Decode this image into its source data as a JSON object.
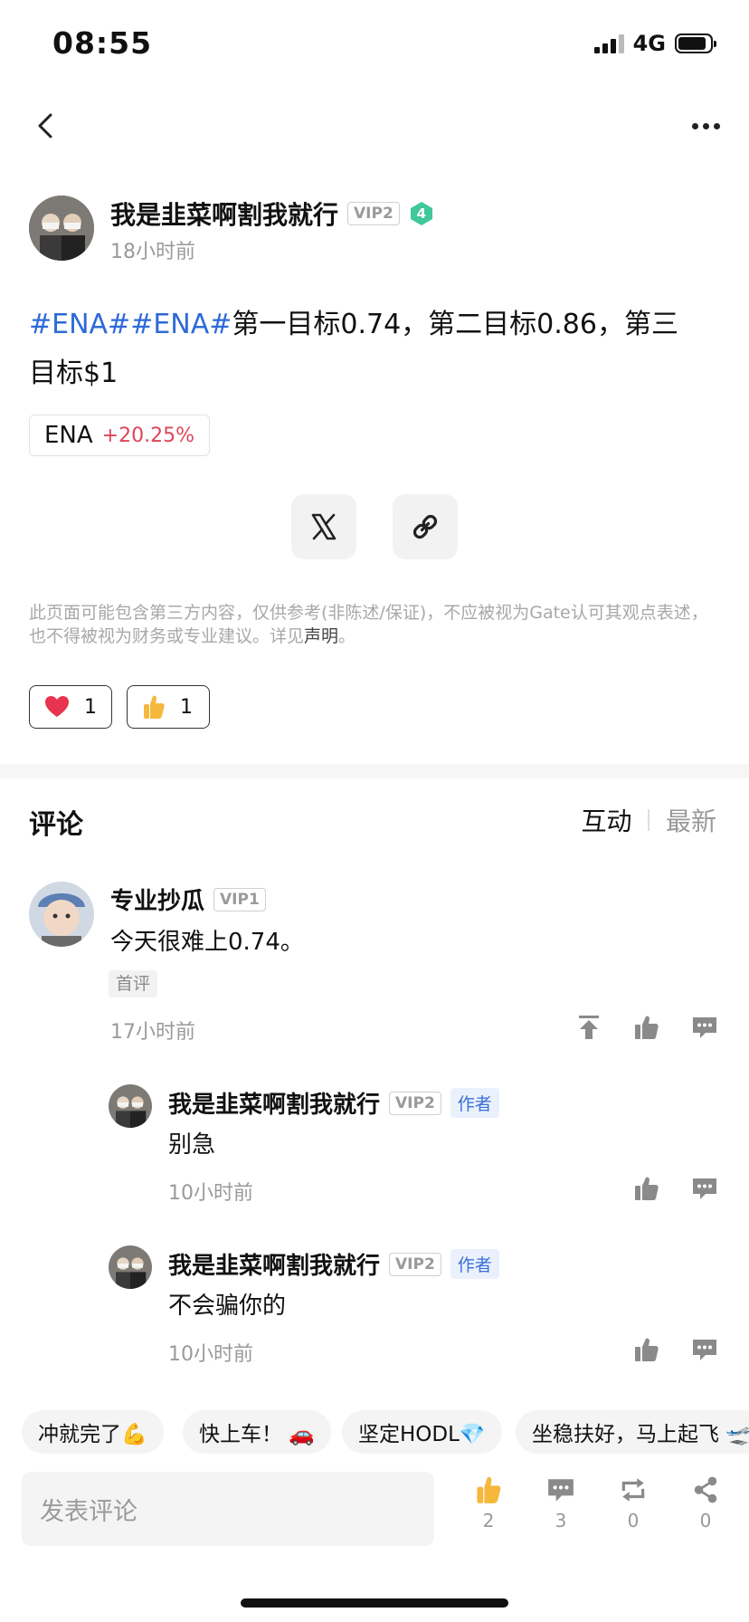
{
  "status_bar": {
    "time": "08:55",
    "network": "4G"
  },
  "post": {
    "author": {
      "name": "我是韭菜啊割我就行",
      "vip": "VIP2",
      "level": "4",
      "time": "18小时前"
    },
    "tags": "#ENA##ENA#",
    "text_line1": "第一目标0.74，第二目标0.86，第三",
    "text_line2": "目标$1",
    "coin": {
      "symbol": "ENA",
      "change": "+20.25%"
    },
    "disclaimer_main": "此页面可能包含第三方内容，仅供参考(非陈述/保证)，不应被视为Gate认可其观点表述，也不得被视为财务或专业建议。详见",
    "disclaimer_link": "声明",
    "disclaimer_end": "。",
    "reactions": [
      {
        "icon": "heart-icon",
        "count": "1"
      },
      {
        "icon": "thumbs-up-emoji-icon",
        "count": "1"
      }
    ]
  },
  "comments_section": {
    "title": "评论",
    "sort_options": [
      "互动",
      "最新"
    ],
    "comments": [
      {
        "name": "专业抄瓜",
        "vip": "VIP1",
        "text": "今天很难上0.74。",
        "badge": "首评",
        "time": "17小时前"
      }
    ],
    "replies": [
      {
        "name": "我是韭菜啊割我就行",
        "vip": "VIP2",
        "badge": "作者",
        "text": "别急",
        "time": "10小时前"
      },
      {
        "name": "我是韭菜啊割我就行",
        "vip": "VIP2",
        "badge": "作者",
        "text": "不会骗你的",
        "time": "10小时前"
      }
    ]
  },
  "quick_replies": [
    "冲就完了💪",
    "快上车！ 🚗",
    "坚定HODL💎",
    "坐稳扶好，马上起飞 🛫"
  ],
  "bottom_bar": {
    "input_placeholder": "发表评论",
    "actions": [
      {
        "icon": "like-icon",
        "count": "2"
      },
      {
        "icon": "comment-icon",
        "count": "3"
      },
      {
        "icon": "repost-icon",
        "count": "0"
      },
      {
        "icon": "share-icon",
        "count": "0"
      }
    ]
  },
  "colors": {
    "tag_blue": "#2e6ad8",
    "up_red": "#e0455a",
    "like_yellow": "#f5b83d"
  }
}
